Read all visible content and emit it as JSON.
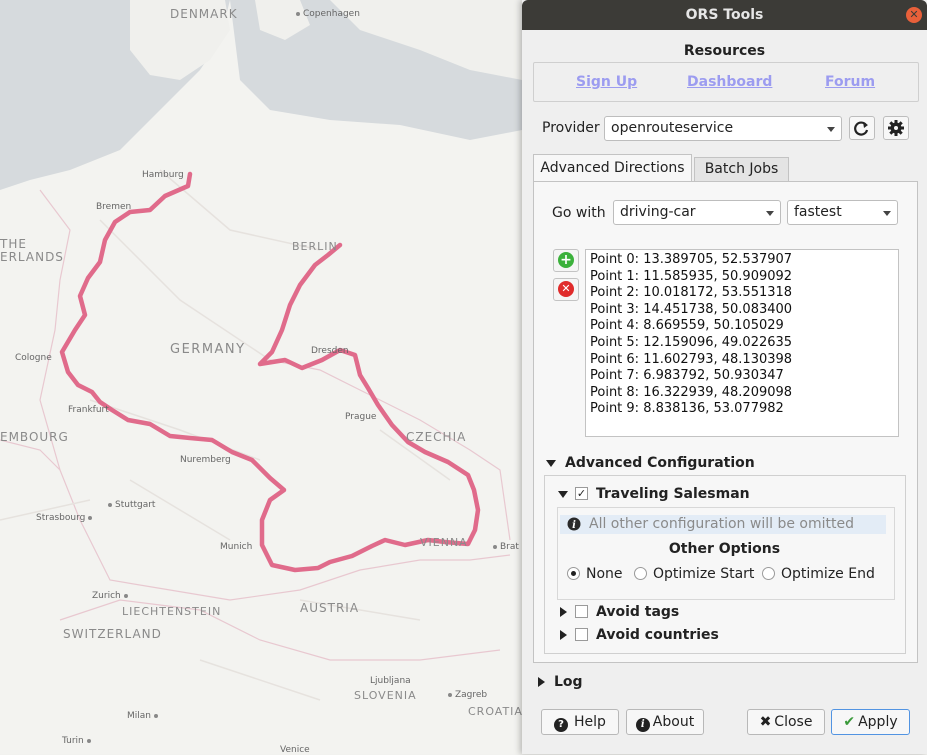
{
  "map": {
    "labels": {
      "denmark": "DENMARK",
      "copenhagen": "Copenhagen",
      "hamburg": "Hamburg",
      "bremen": "Bremen",
      "berlin": "BERLIN",
      "germany": "GERMANY",
      "cologne": "Cologne",
      "frankfurt": "Frankfurt",
      "dresden": "Dresden",
      "prague": "Prague",
      "czechia": "CZECHIA",
      "nuremberg": "Nuremberg",
      "stuttgart": "Stuttgart",
      "strasbourg": "Strasbourg",
      "munich": "Munich",
      "vienna": "VIENNA",
      "brat": "Brat",
      "zurich": "Zurich",
      "liechtenstein": "LIECHTENSTEIN",
      "switzerland": "SWITZERLAND",
      "austria": "AUSTRIA",
      "ljubljana": "Ljubljana",
      "slovenia": "SLOVENIA",
      "zagreb": "Zagreb",
      "croatia": "CROATIA",
      "milan": "Milan",
      "turin": "Turin",
      "venice": "Venice",
      "the": "THE",
      "erlands": "ERLANDS",
      "embourg": "EMBOURG"
    },
    "route_color": "#e06b8b"
  },
  "dialog": {
    "title": "ORS Tools",
    "resources_title": "Resources",
    "links": {
      "signup": "Sign Up",
      "dashboard": "Dashboard",
      "forum": "Forum"
    },
    "provider_label": "Provider",
    "provider_value": "openrouteservice",
    "tabs": [
      "Advanced Directions",
      "Batch Jobs"
    ],
    "go_with_label": "Go with",
    "profile_value": "driving-car",
    "preference_value": "fastest",
    "points": [
      "Point 0: 13.389705, 52.537907",
      "Point 1: 11.585935, 50.909092",
      "Point 2: 10.018172, 53.551318",
      "Point 3: 14.451738, 50.083400",
      "Point 4: 8.669559, 50.105029",
      "Point 5: 12.159096, 49.022635",
      "Point 6: 11.602793, 48.130398",
      "Point 7: 6.983792, 50.930347",
      "Point 8: 16.322939, 48.209098",
      "Point 9: 8.838136, 53.077982"
    ],
    "advanced_config_label": "Advanced Configuration",
    "traveling_salesman_label": "Traveling Salesman",
    "info_text": "All other configuration will be omitted",
    "other_options_label": "Other Options",
    "radio_options": [
      "None",
      "Optimize Start",
      "Optimize End"
    ],
    "avoid_tags_label": "Avoid tags",
    "avoid_countries_label": "Avoid countries",
    "log_label": "Log",
    "buttons": {
      "help": "Help",
      "about": "About",
      "close": "Close",
      "apply": "Apply"
    }
  }
}
